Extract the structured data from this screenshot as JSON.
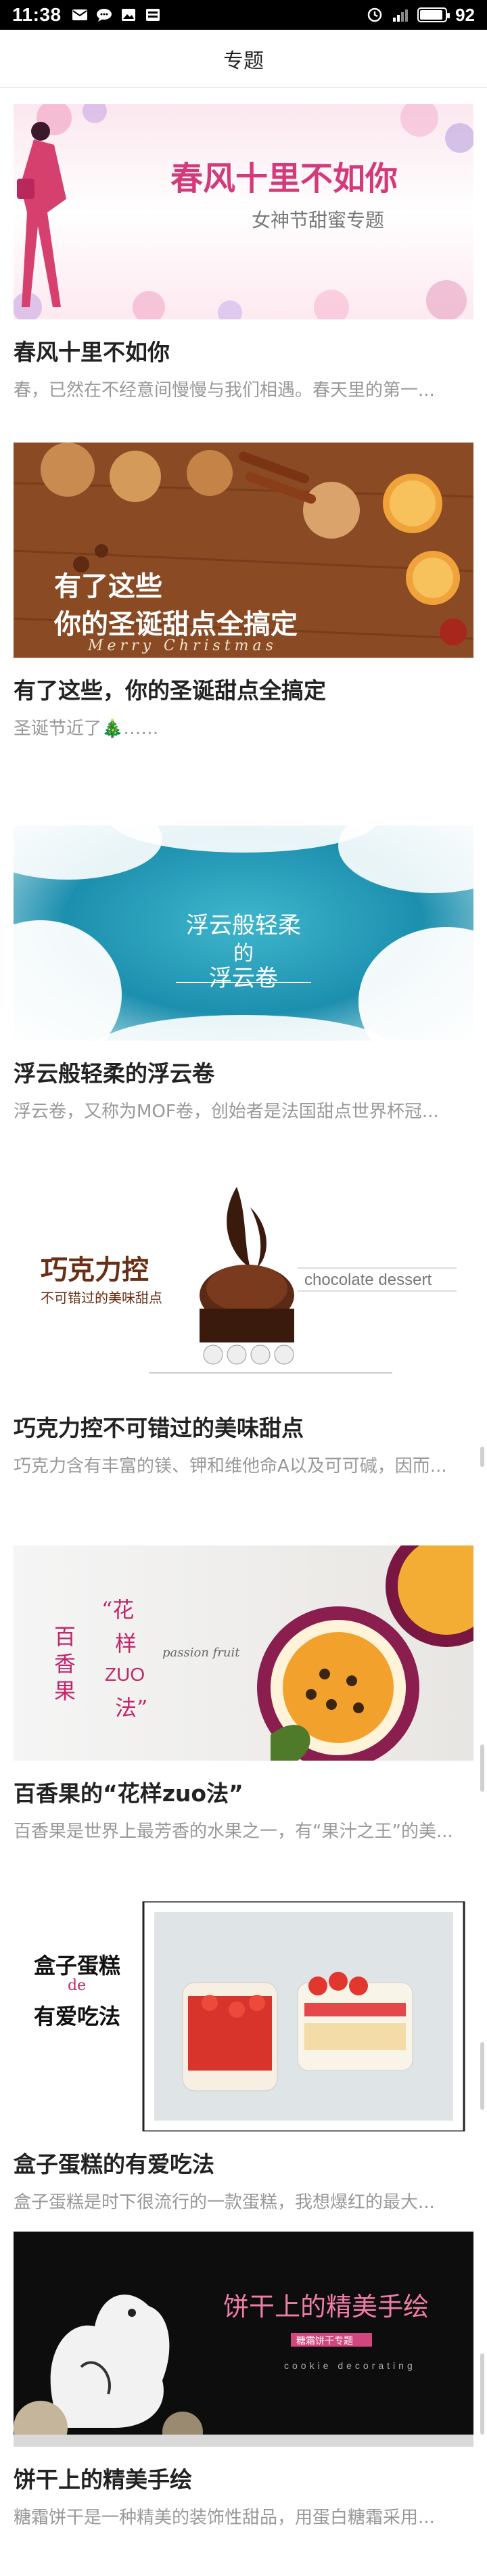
{
  "status_bar": {
    "time": "11:38",
    "battery": "92",
    "battery_level": 0.92
  },
  "header": {
    "title": "专题"
  },
  "articles": [
    {
      "banner_title": "春风十里不如你",
      "banner_subtitle": "女神节甜蜜专题",
      "title": "春风十里不如你",
      "desc": "春，已然在不经意间慢慢与我们相遇。春天里的第一..."
    },
    {
      "banner_title_1": "有了这些",
      "banner_title_2": "你的圣诞甜点全搞定",
      "banner_script": "Merry Christmas",
      "title": "有了这些，你的圣诞甜点全搞定",
      "desc": "圣诞节近了🎄……"
    },
    {
      "banner_title_1": "浮云般轻柔",
      "banner_title_2": "的",
      "banner_title_3": "浮云卷",
      "title": "浮云般轻柔的浮云卷",
      "desc": "浮云卷，又称为MOF卷，创始者是法国甜点世界杯冠..."
    },
    {
      "banner_title": "巧克力控",
      "banner_subtitle": "不可错过的美味甜点",
      "banner_english": "chocolate dessert",
      "title": "巧克力控不可错过的美味甜点",
      "desc": "巧克力含有丰富的镁、钾和维他命A以及可可碱，因而..."
    },
    {
      "banner_chars": [
        "百",
        "香",
        "果",
        "“花",
        "样",
        "ZUO",
        "法”"
      ],
      "banner_english": "passion fruit",
      "title": "百香果的“花样zuo法”",
      "desc": "百香果是世界上最芳香的水果之一，有“果汁之王”的美..."
    },
    {
      "banner_title_1": "盒子蛋糕",
      "banner_title_de": "de",
      "banner_title_2": "有爱吃法",
      "title": "盒子蛋糕的有爱吃法",
      "desc": "盒子蛋糕是时下很流行的一款蛋糕，我想爆红的最大..."
    },
    {
      "banner_title": "饼干上的精美手绘",
      "banner_tag": "糖霜饼干专题",
      "banner_english": "cookie decorating",
      "title": "饼干上的精美手绘",
      "desc": "糖霜饼干是一种精美的装饰性甜品，用蛋白糖霜采用..."
    }
  ],
  "colors": {
    "accent_pink": "#d23a7a",
    "title_text": "#222222",
    "desc_text": "#999999"
  },
  "icons": [
    "mail-icon",
    "message-icon",
    "gallery-icon",
    "image-icon",
    "alarm-icon",
    "signal-icon",
    "battery-icon"
  ]
}
